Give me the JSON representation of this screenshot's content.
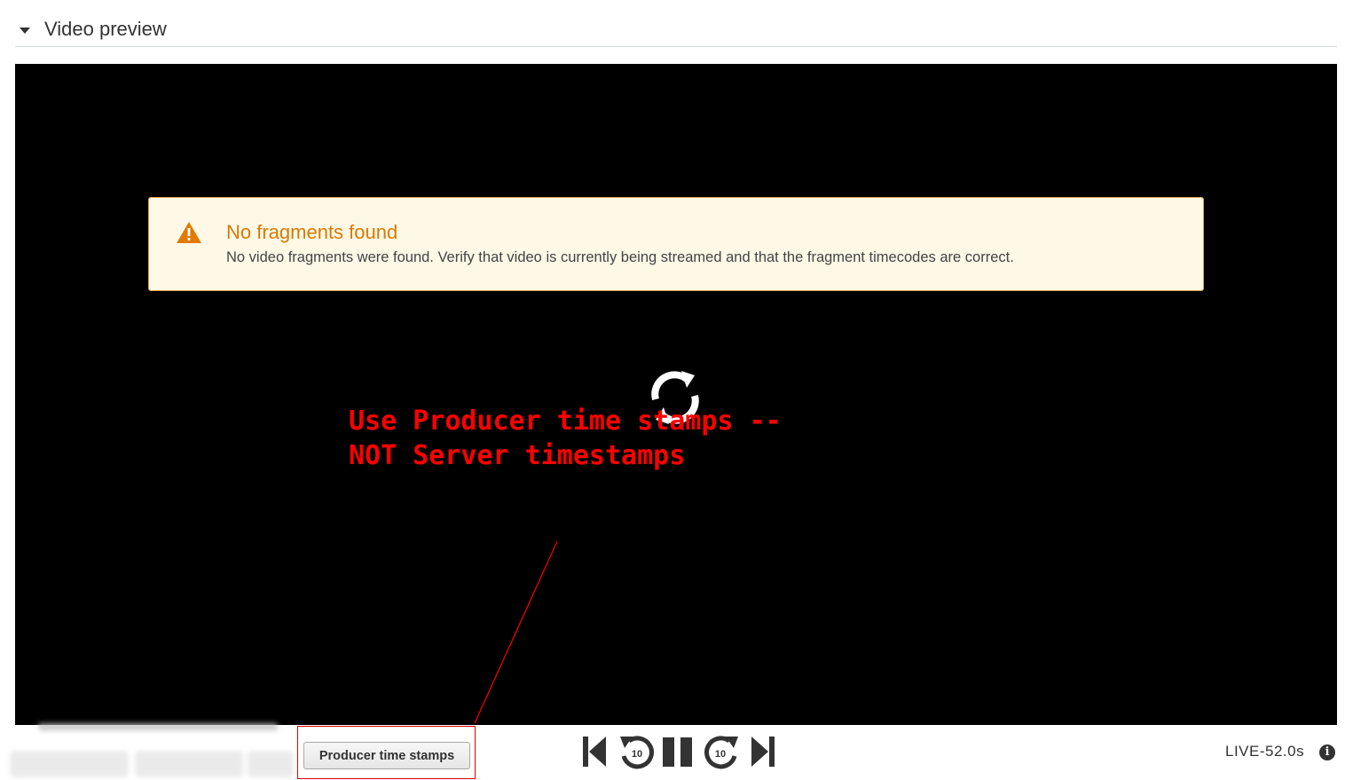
{
  "section": {
    "title": "Video preview",
    "toggle_icon": "caret-down-icon"
  },
  "alert": {
    "icon": "warning-icon",
    "title": "No fragments found",
    "message": "No video fragments were found. Verify that video is currently being streamed and that the fragment timecodes are correct.",
    "colors": {
      "background": "#fef8e7",
      "border": "#e0a246",
      "title": "#d97a00",
      "icon": "#e07b00"
    }
  },
  "player": {
    "loading_icon": "refresh-icon",
    "timestamp_button_label": "Producer time stamps",
    "controls": [
      {
        "icon": "skip-to-start-icon"
      },
      {
        "icon": "rewind-10-icon",
        "label": "10"
      },
      {
        "icon": "pause-icon"
      },
      {
        "icon": "forward-10-icon",
        "label": "10"
      },
      {
        "icon": "skip-to-end-icon"
      }
    ],
    "live_label": "LIVE-52.0s",
    "info_icon": "info-icon"
  },
  "annotation": {
    "lines": [
      "Use Producer time stamps --",
      "NOT Server timestamps"
    ],
    "color": "#ff0000"
  }
}
